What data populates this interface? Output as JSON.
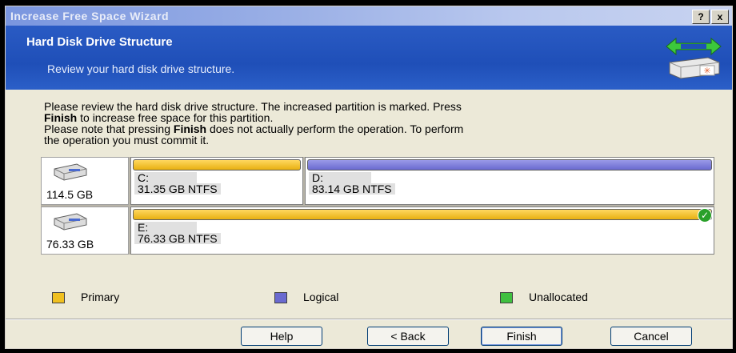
{
  "window": {
    "title": "Increase Free Space Wizard",
    "help_btn": "?",
    "close_btn": "x"
  },
  "header": {
    "title": "Hard Disk Drive Structure",
    "subtitle": "Review your hard disk drive structure."
  },
  "description": {
    "line1": "Please review the hard disk drive structure. The increased partition is marked. Press",
    "line2_bold": "Finish",
    "line2_rest": " to increase free space for this partition.",
    "line3_pre": "Please note that pressing ",
    "line3_bold": "Finish",
    "line3_rest": " does not actually perform the operation. To perform",
    "line4": "the operation you must commit it."
  },
  "disks": [
    {
      "size": "114.5 GB",
      "partitions": [
        {
          "name": "C:",
          "info": "31.35 GB  NTFS",
          "type": "primary"
        },
        {
          "name": "D:",
          "info": "83.14 GB  NTFS",
          "type": "logical"
        }
      ]
    },
    {
      "size": "76.33 GB",
      "partitions": [
        {
          "name": "E:",
          "info": "76.33 GB  NTFS",
          "type": "primary",
          "marked": true
        }
      ]
    }
  ],
  "legend": {
    "primary": {
      "label": "Primary",
      "color": "#f0c020"
    },
    "logical": {
      "label": "Logical",
      "color": "#6a6ad0"
    },
    "unallocated": {
      "label": "Unallocated",
      "color": "#40c040"
    }
  },
  "buttons": {
    "help": "Help",
    "back": "< Back",
    "finish": "Finish",
    "cancel": "Cancel"
  },
  "icons": {
    "header": "disk-arrows-icon",
    "disk": "hard-disk-icon",
    "marked": "checkmark-icon"
  }
}
